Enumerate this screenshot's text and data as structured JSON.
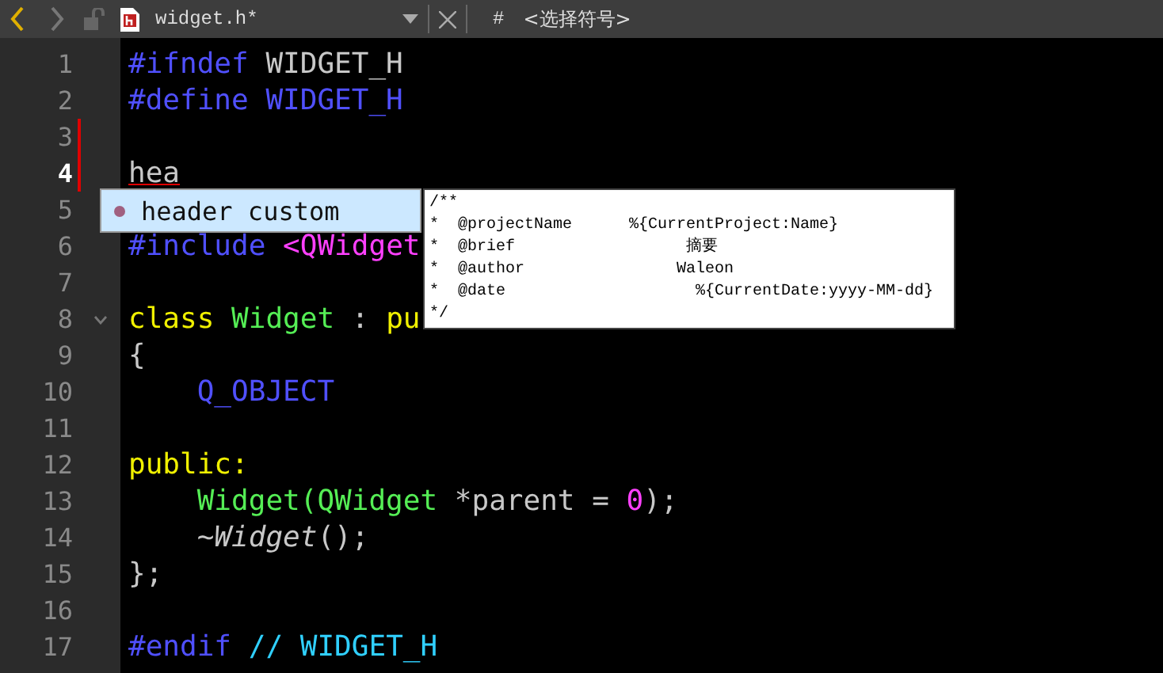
{
  "toolbar": {
    "file_name": "widget.h*",
    "symbol_hash": "#",
    "symbol_placeholder": "<选择符号>"
  },
  "lines": [
    {
      "number": "1",
      "current": false,
      "modified": false,
      "foldable": false,
      "indented": false,
      "segments": [
        {
          "text": "#ifndef",
          "kind": "preproc"
        },
        {
          "text": " WIDGET_H",
          "kind": "plain"
        }
      ]
    },
    {
      "number": "2",
      "current": false,
      "modified": false,
      "foldable": false,
      "indented": false,
      "segments": [
        {
          "text": "#define WIDGET_H",
          "kind": "preproc"
        }
      ]
    },
    {
      "number": "3",
      "current": false,
      "modified": true,
      "foldable": false,
      "indented": false
    },
    {
      "number": "4",
      "current": true,
      "modified": true,
      "foldable": false,
      "indented": false,
      "segments": [
        {
          "text": "hea",
          "kind": "error"
        }
      ]
    },
    {
      "number": "5",
      "current": false,
      "modified": false,
      "foldable": false,
      "indented": false
    },
    {
      "number": "6",
      "current": false,
      "modified": false,
      "foldable": false,
      "indented": false,
      "segments": [
        {
          "text": "#include ",
          "kind": "preproc"
        },
        {
          "text": "<QWidget",
          "kind": "string"
        }
      ]
    },
    {
      "number": "7",
      "current": false,
      "modified": false,
      "foldable": false,
      "indented": false
    },
    {
      "number": "8",
      "current": false,
      "modified": false,
      "foldable": true,
      "indented": false,
      "segments": [
        {
          "text": "class",
          "kind": "keyword"
        },
        {
          "text": " Widget",
          "kind": "type"
        },
        {
          "text": " : ",
          "kind": "plain"
        },
        {
          "text": "pu",
          "kind": "keyword"
        }
      ]
    },
    {
      "number": "9",
      "current": false,
      "modified": false,
      "foldable": false,
      "indented": false,
      "segments": [
        {
          "text": "{",
          "kind": "plain"
        }
      ]
    },
    {
      "number": "10",
      "current": false,
      "modified": false,
      "foldable": false,
      "indented": true,
      "segments": [
        {
          "text": "Q_OBJECT",
          "kind": "preproc"
        }
      ]
    },
    {
      "number": "11",
      "current": false,
      "modified": false,
      "foldable": false,
      "indented": false
    },
    {
      "number": "12",
      "current": false,
      "modified": false,
      "foldable": false,
      "indented": false,
      "segments": [
        {
          "text": "public:",
          "kind": "keyword"
        }
      ]
    },
    {
      "number": "13",
      "current": false,
      "modified": false,
      "foldable": false,
      "indented": true,
      "segments": [
        {
          "text": "Widget(QWidget",
          "kind": "type"
        },
        {
          "text": " *parent = ",
          "kind": "plain"
        },
        {
          "text": "0",
          "kind": "number"
        },
        {
          "text": ");",
          "kind": "plain"
        }
      ]
    },
    {
      "number": "14",
      "current": false,
      "modified": false,
      "foldable": false,
      "indented": true,
      "segments": [
        {
          "text": "~",
          "kind": "plain"
        },
        {
          "text": "Widget",
          "kind": "italic"
        },
        {
          "text": "();",
          "kind": "plain"
        }
      ]
    },
    {
      "number": "15",
      "current": false,
      "modified": false,
      "foldable": false,
      "indented": false,
      "segments": [
        {
          "text": "};",
          "kind": "plain"
        }
      ]
    },
    {
      "number": "16",
      "current": false,
      "modified": false,
      "foldable": false,
      "indented": false
    },
    {
      "number": "17",
      "current": false,
      "modified": false,
      "foldable": false,
      "indented": false,
      "segments": [
        {
          "text": "#endif",
          "kind": "preproc"
        },
        {
          "text": " // WIDGET_H",
          "kind": "comment"
        }
      ]
    }
  ],
  "completion": {
    "items": [
      {
        "label": "header custom",
        "selected": true
      }
    ],
    "tooltip": [
      "/**",
      "*  @projectName      %{CurrentProject:Name}",
      "*  @brief                  摘要",
      "*  @author                Waleon",
      "*  @date                    %{CurrentDate:yyyy-MM-dd}",
      "*/"
    ]
  }
}
